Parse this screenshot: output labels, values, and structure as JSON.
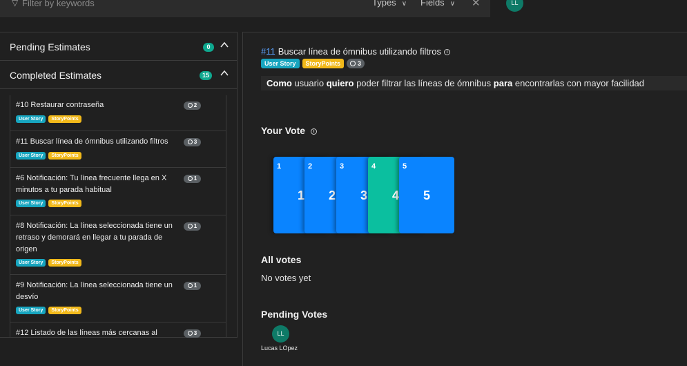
{
  "filter": {
    "placeholder": "Filter by keywords",
    "types_label": "Types",
    "fields_label": "Fields"
  },
  "user": {
    "initials": "LL",
    "name": "Lucas LOpez"
  },
  "sections": {
    "pending": {
      "label": "Pending Estimates",
      "count": "0"
    },
    "completed": {
      "label": "Completed Estimates",
      "count": "15"
    }
  },
  "tags": {
    "user_story": "User Story",
    "story_points": "StoryPoints"
  },
  "items": [
    {
      "title": "#10 Restaurar contraseña",
      "estimate": "2"
    },
    {
      "title": "#11 Buscar línea de ómnibus utilizando filtros",
      "estimate": "3"
    },
    {
      "title": "#6 Notificación: Tu línea frecuente llega en X minutos a tu parada habitual",
      "estimate": "1"
    },
    {
      "title": "#8 Notificación: La línea seleccionada tiene un retraso y demorará en llegar a tu parada de origen",
      "estimate": "1"
    },
    {
      "title": "#9 Notificación: La línea seleccionada tiene un desvío",
      "estimate": "1"
    },
    {
      "title": "#12 Listado de las líneas más cercanas al",
      "estimate": "3"
    }
  ],
  "work_item": {
    "number": "#11",
    "title": "Buscar línea de ómnibus utilizando filtros",
    "estimate": "3",
    "story": {
      "w1": "Como",
      "t1": " usuario ",
      "w2": "quiero",
      "t2": " poder filtrar las líneas de ómnibus ",
      "w3": "para",
      "t3": " encontrarlas con mayor facilidad"
    }
  },
  "your_vote": {
    "heading": "Your Vote",
    "cards": [
      "1",
      "2",
      "3",
      "4",
      "5"
    ],
    "selected": "4",
    "colors": {
      "card": "#0a84ff",
      "selected": "#0bbf9f"
    }
  },
  "all_votes": {
    "heading": "All votes",
    "text": "No votes yet"
  },
  "pending_votes": {
    "heading": "Pending Votes"
  }
}
